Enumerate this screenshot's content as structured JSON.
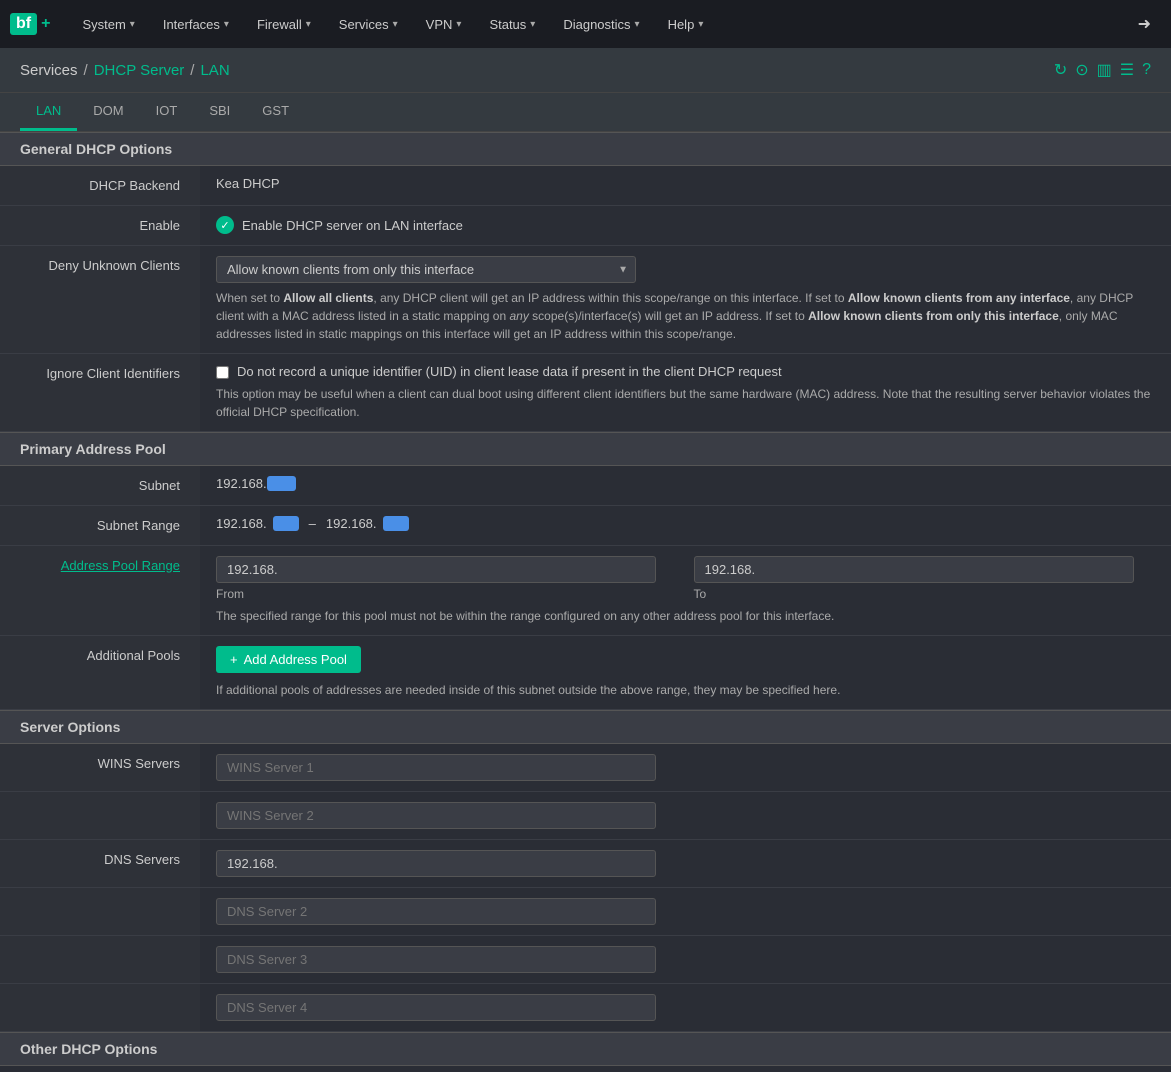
{
  "brand": {
    "logo": "bf",
    "plus": "+",
    "logout_icon": "➜"
  },
  "nav": {
    "items": [
      {
        "label": "System",
        "has_arrow": true
      },
      {
        "label": "Interfaces",
        "has_arrow": true
      },
      {
        "label": "Firewall",
        "has_arrow": true
      },
      {
        "label": "Services",
        "has_arrow": true
      },
      {
        "label": "VPN",
        "has_arrow": true
      },
      {
        "label": "Status",
        "has_arrow": true
      },
      {
        "label": "Diagnostics",
        "has_arrow": true
      },
      {
        "label": "Help",
        "has_arrow": true
      }
    ]
  },
  "breadcrumb": {
    "services": "Services",
    "dhcp_server": "DHCP Server",
    "interface": "LAN",
    "separator": "/"
  },
  "breadcrumb_icons": [
    "↻",
    "●",
    "▥",
    "≡",
    "?"
  ],
  "tabs": [
    {
      "id": "lan",
      "label": "LAN",
      "active": true
    },
    {
      "id": "dom",
      "label": "DOM",
      "active": false
    },
    {
      "id": "iot",
      "label": "IOT",
      "active": false
    },
    {
      "id": "sbi",
      "label": "SBI",
      "active": false
    },
    {
      "id": "gst",
      "label": "GST",
      "active": false
    }
  ],
  "sections": {
    "general": {
      "title": "General DHCP Options",
      "fields": {
        "dhcp_backend_label": "DHCP Backend",
        "dhcp_backend_value": "Kea DHCP",
        "enable_label": "Enable",
        "enable_text": "Enable DHCP server on LAN interface",
        "deny_unknown_label": "Deny Unknown Clients",
        "deny_unknown_select": "Allow known clients from only this interface",
        "deny_unknown_options": [
          "Allow all clients",
          "Allow known clients from any interface",
          "Allow known clients from only this interface"
        ],
        "deny_unknown_help": "When set to Allow all clients, any DHCP client will get an IP address within this scope/range on this interface. If set to Allow known clients from any interface, any DHCP client with a MAC address listed in a static mapping on any scope(s)/interface(s) will get an IP address. If set to Allow known clients from only this interface, only MAC addresses listed in static mappings on this interface will get an IP address within this scope/range.",
        "ignore_client_label": "Ignore Client Identifiers",
        "ignore_client_checkbox_text": "Do not record a unique identifier (UID) in client lease data if present in the client DHCP request",
        "ignore_client_help": "This option may be useful when a client can dual boot using different client identifiers but the same hardware (MAC) address. Note that the resulting server behavior violates the official DHCP specification."
      }
    },
    "primary_pool": {
      "title": "Primary Address Pool",
      "fields": {
        "subnet_label": "Subnet",
        "subnet_value": "192.168.[redacted]",
        "subnet_range_label": "Subnet Range",
        "subnet_range_from": "192.168.[redacted]",
        "subnet_range_to": "192.168.[redacted]",
        "address_pool_label": "Address Pool Range",
        "pool_from_placeholder": "192.168.[redacted]",
        "pool_to_placeholder": "192.168.[redacted]",
        "pool_from_label": "From",
        "pool_to_label": "To",
        "pool_help": "The specified range for this pool must not be within the range configured on any other address pool for this interface.",
        "additional_pools_label": "Additional Pools",
        "add_pool_btn": "+ Add Address Pool",
        "additional_pools_help": "If additional pools of addresses are needed inside of this subnet outside the above range, they may be specified here."
      }
    },
    "server_options": {
      "title": "Server Options",
      "fields": {
        "wins_label": "WINS Servers",
        "wins1_placeholder": "WINS Server 1",
        "wins2_placeholder": "WINS Server 2",
        "dns_label": "DNS Servers",
        "dns1_value": "192.168.[redacted]",
        "dns2_placeholder": "DNS Server 2",
        "dns3_placeholder": "DNS Server 3",
        "dns4_placeholder": "DNS Server 4"
      }
    },
    "other": {
      "title": "Other DHCP Options"
    }
  }
}
